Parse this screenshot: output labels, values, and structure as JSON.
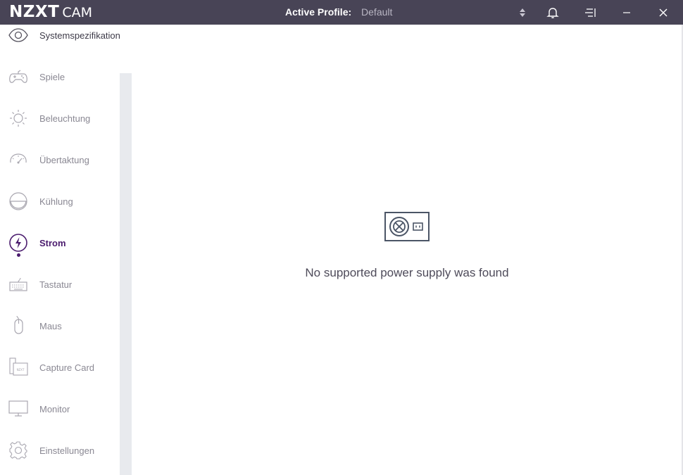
{
  "app": {
    "brand": "NZXT",
    "name": "CAM"
  },
  "header": {
    "profile_label": "Active Profile:",
    "profile_value": "Default",
    "icons": [
      "profile-switch-icon",
      "bell-icon",
      "menu-icon",
      "minimize-icon",
      "close-icon"
    ]
  },
  "sidebar": {
    "items": [
      {
        "label": "Systemspezifikation",
        "icon": "eye-icon",
        "state": "dark"
      },
      {
        "label": "Spiele",
        "icon": "gamepad-icon",
        "state": "default"
      },
      {
        "label": "Beleuchtung",
        "icon": "sun-icon",
        "state": "default"
      },
      {
        "label": "Übertaktung",
        "icon": "speedometer-icon",
        "state": "default"
      },
      {
        "label": "Kühlung",
        "icon": "cooling-icon",
        "state": "default"
      },
      {
        "label": "Strom",
        "icon": "lightning-icon",
        "state": "active"
      },
      {
        "label": "Tastatur",
        "icon": "keyboard-icon",
        "state": "default"
      },
      {
        "label": "Maus",
        "icon": "mouse-icon",
        "state": "default"
      },
      {
        "label": "Capture Card",
        "icon": "capture-card-icon",
        "state": "default"
      },
      {
        "label": "Monitor",
        "icon": "monitor-icon",
        "state": "default"
      },
      {
        "label": "Einstellungen",
        "icon": "gear-icon",
        "state": "default"
      }
    ]
  },
  "main": {
    "message": "No supported power supply was found",
    "icon": "power-supply-icon"
  },
  "colors": {
    "titlebar": "#484456",
    "accent": "#4b1c6e",
    "icon_gray": "#a9a7b0",
    "scroll_track": "#e8eaee"
  }
}
